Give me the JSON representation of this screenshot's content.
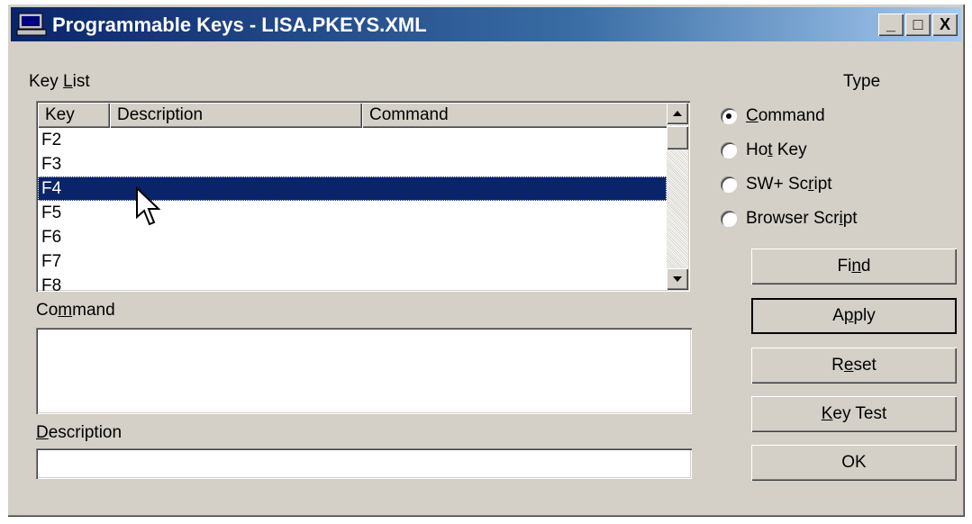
{
  "window": {
    "title": "Programmable Keys - LISA.PKEYS.XML",
    "minimize": "_",
    "maximize": "□",
    "close": "X"
  },
  "key_list": {
    "label_pre": "Key ",
    "label_u": "L",
    "label_post": "ist",
    "columns": [
      "Key",
      "Description",
      "Command"
    ],
    "rows": [
      "F2",
      "F3",
      "F4",
      "F5",
      "F6",
      "F7",
      "F8"
    ],
    "selected": "F4"
  },
  "command": {
    "label_pre": "Co",
    "label_u": "m",
    "label_post": "mand",
    "value": ""
  },
  "description": {
    "label_u": "D",
    "label_post": "escription",
    "value": ""
  },
  "type": {
    "label": "Type",
    "options": [
      {
        "pre": "",
        "u": "C",
        "post": "ommand",
        "checked": true
      },
      {
        "pre": "Ho",
        "u": "t",
        "post": " Key",
        "checked": false
      },
      {
        "pre": "SW+ Sc",
        "u": "r",
        "post": "ipt",
        "checked": false
      },
      {
        "pre": "Browser Scr",
        "u": "i",
        "post": "pt",
        "checked": false
      }
    ]
  },
  "buttons": {
    "find": {
      "pre": "Fi",
      "u": "n",
      "post": "d"
    },
    "apply": {
      "pre": "A",
      "u": "p",
      "post": "ply"
    },
    "reset": {
      "pre": "R",
      "u": "e",
      "post": "set"
    },
    "key_test": {
      "pre": "",
      "u": "K",
      "post": "ey Test"
    },
    "ok": {
      "pre": "OK",
      "u": "",
      "post": ""
    }
  }
}
